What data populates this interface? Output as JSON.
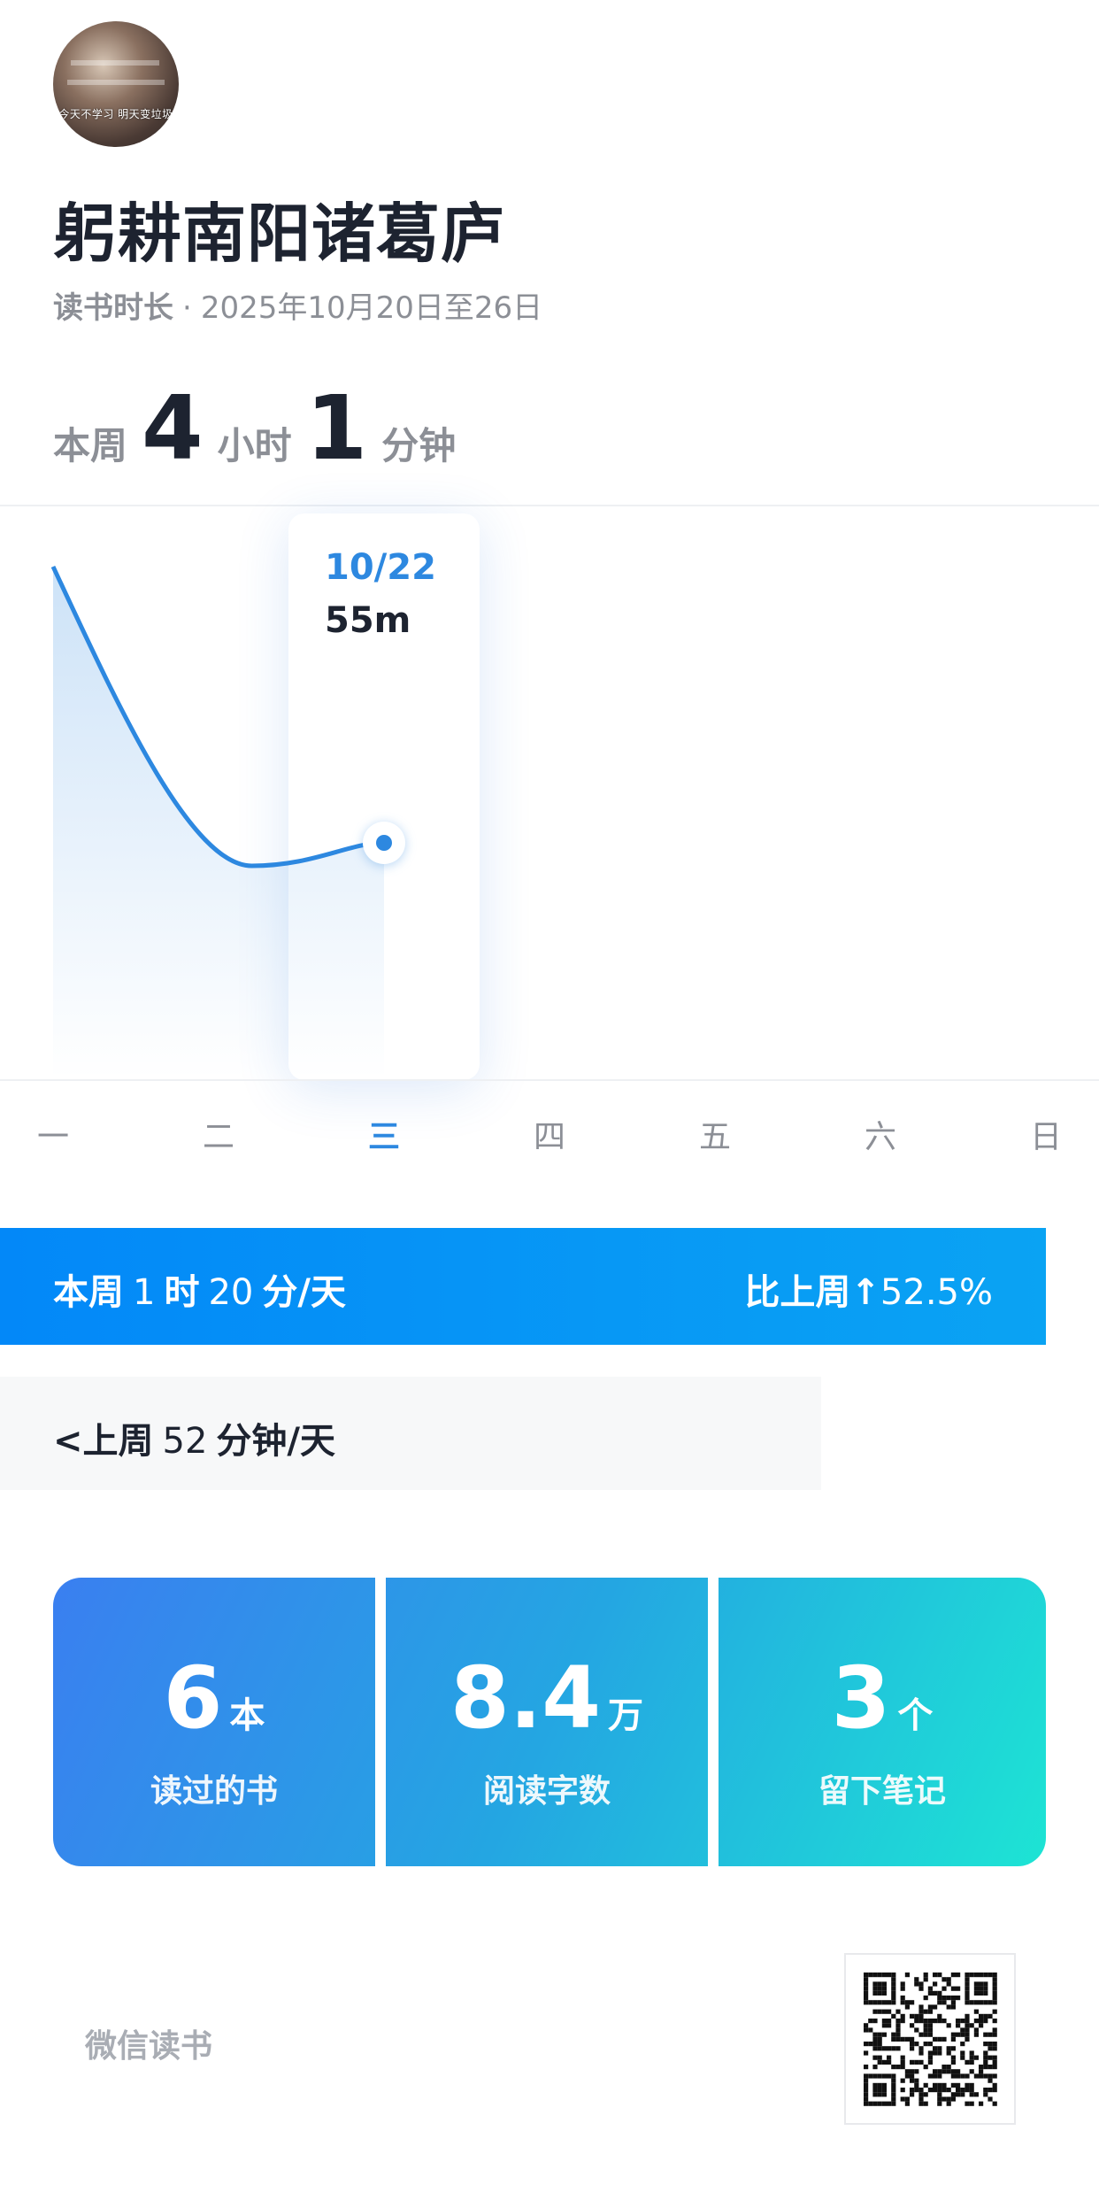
{
  "profile": {
    "avatar_caption": "今天不学习 明天变垃圾",
    "name": "躬耕南阳诸葛庐"
  },
  "subtitle": {
    "label": "读书时长",
    "separator": "·",
    "range": "2025年10月20日至26日"
  },
  "week_total": {
    "prefix": "本周",
    "hours": "4",
    "hours_unit": "小时",
    "minutes": "1",
    "minutes_unit": "分钟"
  },
  "chart_data": {
    "type": "area",
    "categories": [
      "一",
      "二",
      "三",
      "四",
      "五",
      "六",
      "日"
    ],
    "values": [
      94,
      null,
      55,
      null,
      null,
      null,
      null
    ],
    "unit": "m",
    "selected_index": 2,
    "tooltip": {
      "date": "10/22",
      "value": "55m"
    }
  },
  "banner": {
    "prefix": "本周",
    "hours": "1",
    "hours_unit": "时",
    "minutes": "20",
    "minutes_unit": "分/天",
    "compare_label": "比上周",
    "arrow": "↑",
    "percent": "52.5%",
    "color": "#0a97f5"
  },
  "last_week": {
    "chevron": "<",
    "prefix": "上周",
    "minutes": "52",
    "unit": "分钟/天"
  },
  "stats": [
    {
      "value": "6",
      "unit": "本",
      "label": "读过的书"
    },
    {
      "value": "8.4",
      "unit": "万",
      "label": "阅读字数"
    },
    {
      "value": "3",
      "unit": "个",
      "label": "留下笔记"
    }
  ],
  "footer": {
    "brand": "微信读书",
    "qr_icon": "qr-code-icon"
  },
  "colors": {
    "accent": "#2d88e0",
    "title": "#1d2330",
    "muted": "#8c8f96"
  }
}
